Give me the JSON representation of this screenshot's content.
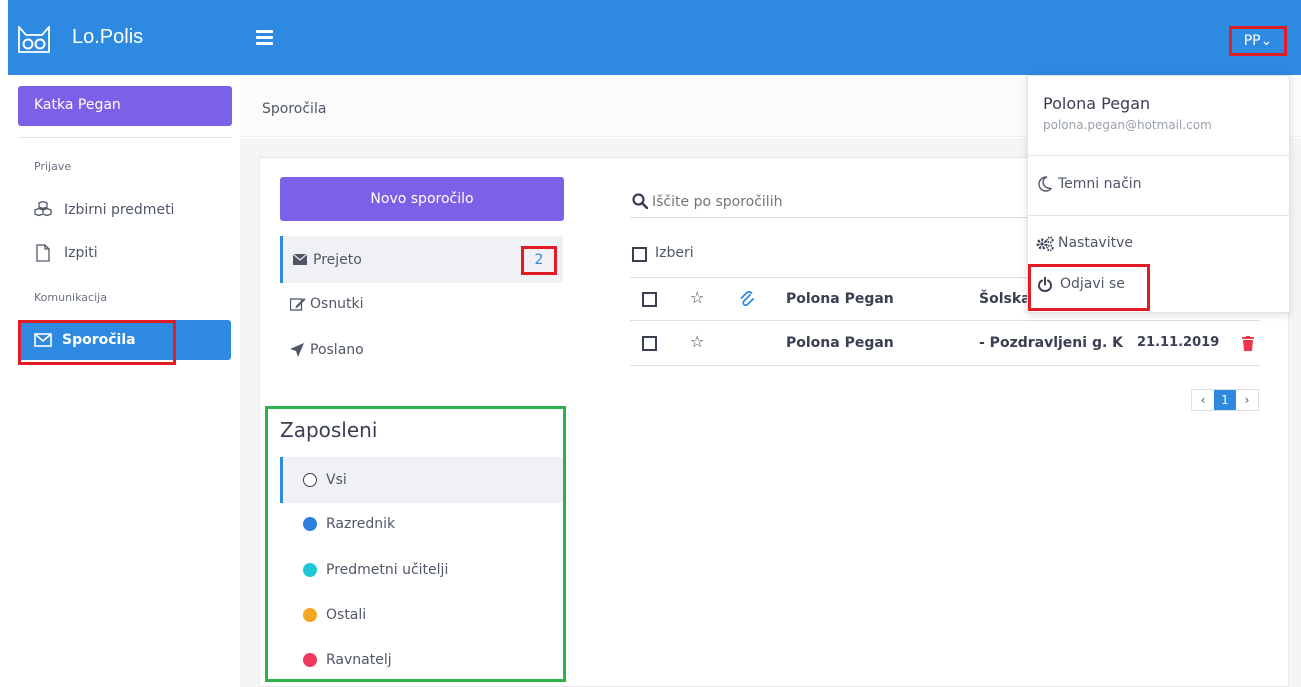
{
  "header": {
    "brand": "Lo.Polis",
    "user_initials": "PP",
    "accent": "#2d8ae0"
  },
  "sidebar": {
    "user_name": "Katka Pegan",
    "sections": [
      {
        "title": "Prijave",
        "items": [
          {
            "label": "Izbirni predmeti",
            "icon": "cubes-icon"
          },
          {
            "label": "Izpiti",
            "icon": "file-icon"
          }
        ]
      },
      {
        "title": "Komunikacija",
        "items": [
          {
            "label": "Sporočila",
            "icon": "envelope-icon",
            "active": true
          }
        ]
      }
    ]
  },
  "breadcrumb": "Sporočila",
  "messages": {
    "new_button": "Novo sporočilo",
    "folders": [
      {
        "label": "Prejeto",
        "icon": "envelope-icon",
        "count": "2"
      },
      {
        "label": "Osnutki",
        "icon": "edit-icon"
      },
      {
        "label": "Poslano",
        "icon": "send-icon"
      }
    ],
    "filters_title": "Zaposleni",
    "filters": [
      {
        "label": "Vsi",
        "color": "none"
      },
      {
        "label": "Razrednik",
        "color": "#2d7fe0"
      },
      {
        "label": "Predmetni učitelji",
        "color": "#1fc8d6"
      },
      {
        "label": "Ostali",
        "color": "#f5a623"
      },
      {
        "label": "Ravnatelj",
        "color": "#f03a5f"
      }
    ],
    "search_placeholder": "Iščite po sporočilih",
    "select_label": "Izberi",
    "rows": [
      {
        "sender": "Polona Pegan",
        "subject": "Šolska",
        "date": "",
        "attachment": true
      },
      {
        "sender": "Polona Pegan",
        "subject": "- Pozdravljeni g. K",
        "date": "21.11.2019",
        "attachment": false
      }
    ],
    "pagination": {
      "prev": "‹",
      "current": "1",
      "next": "›"
    }
  },
  "user_menu": {
    "name": "Polona Pegan",
    "email": "polona.pegan@hotmail.com",
    "items": [
      {
        "label": "Temni način",
        "icon": "moon-icon"
      },
      {
        "label": "Nastavitve",
        "icon": "cogs-icon"
      },
      {
        "label": "Odjavi se",
        "icon": "power-icon"
      }
    ]
  }
}
